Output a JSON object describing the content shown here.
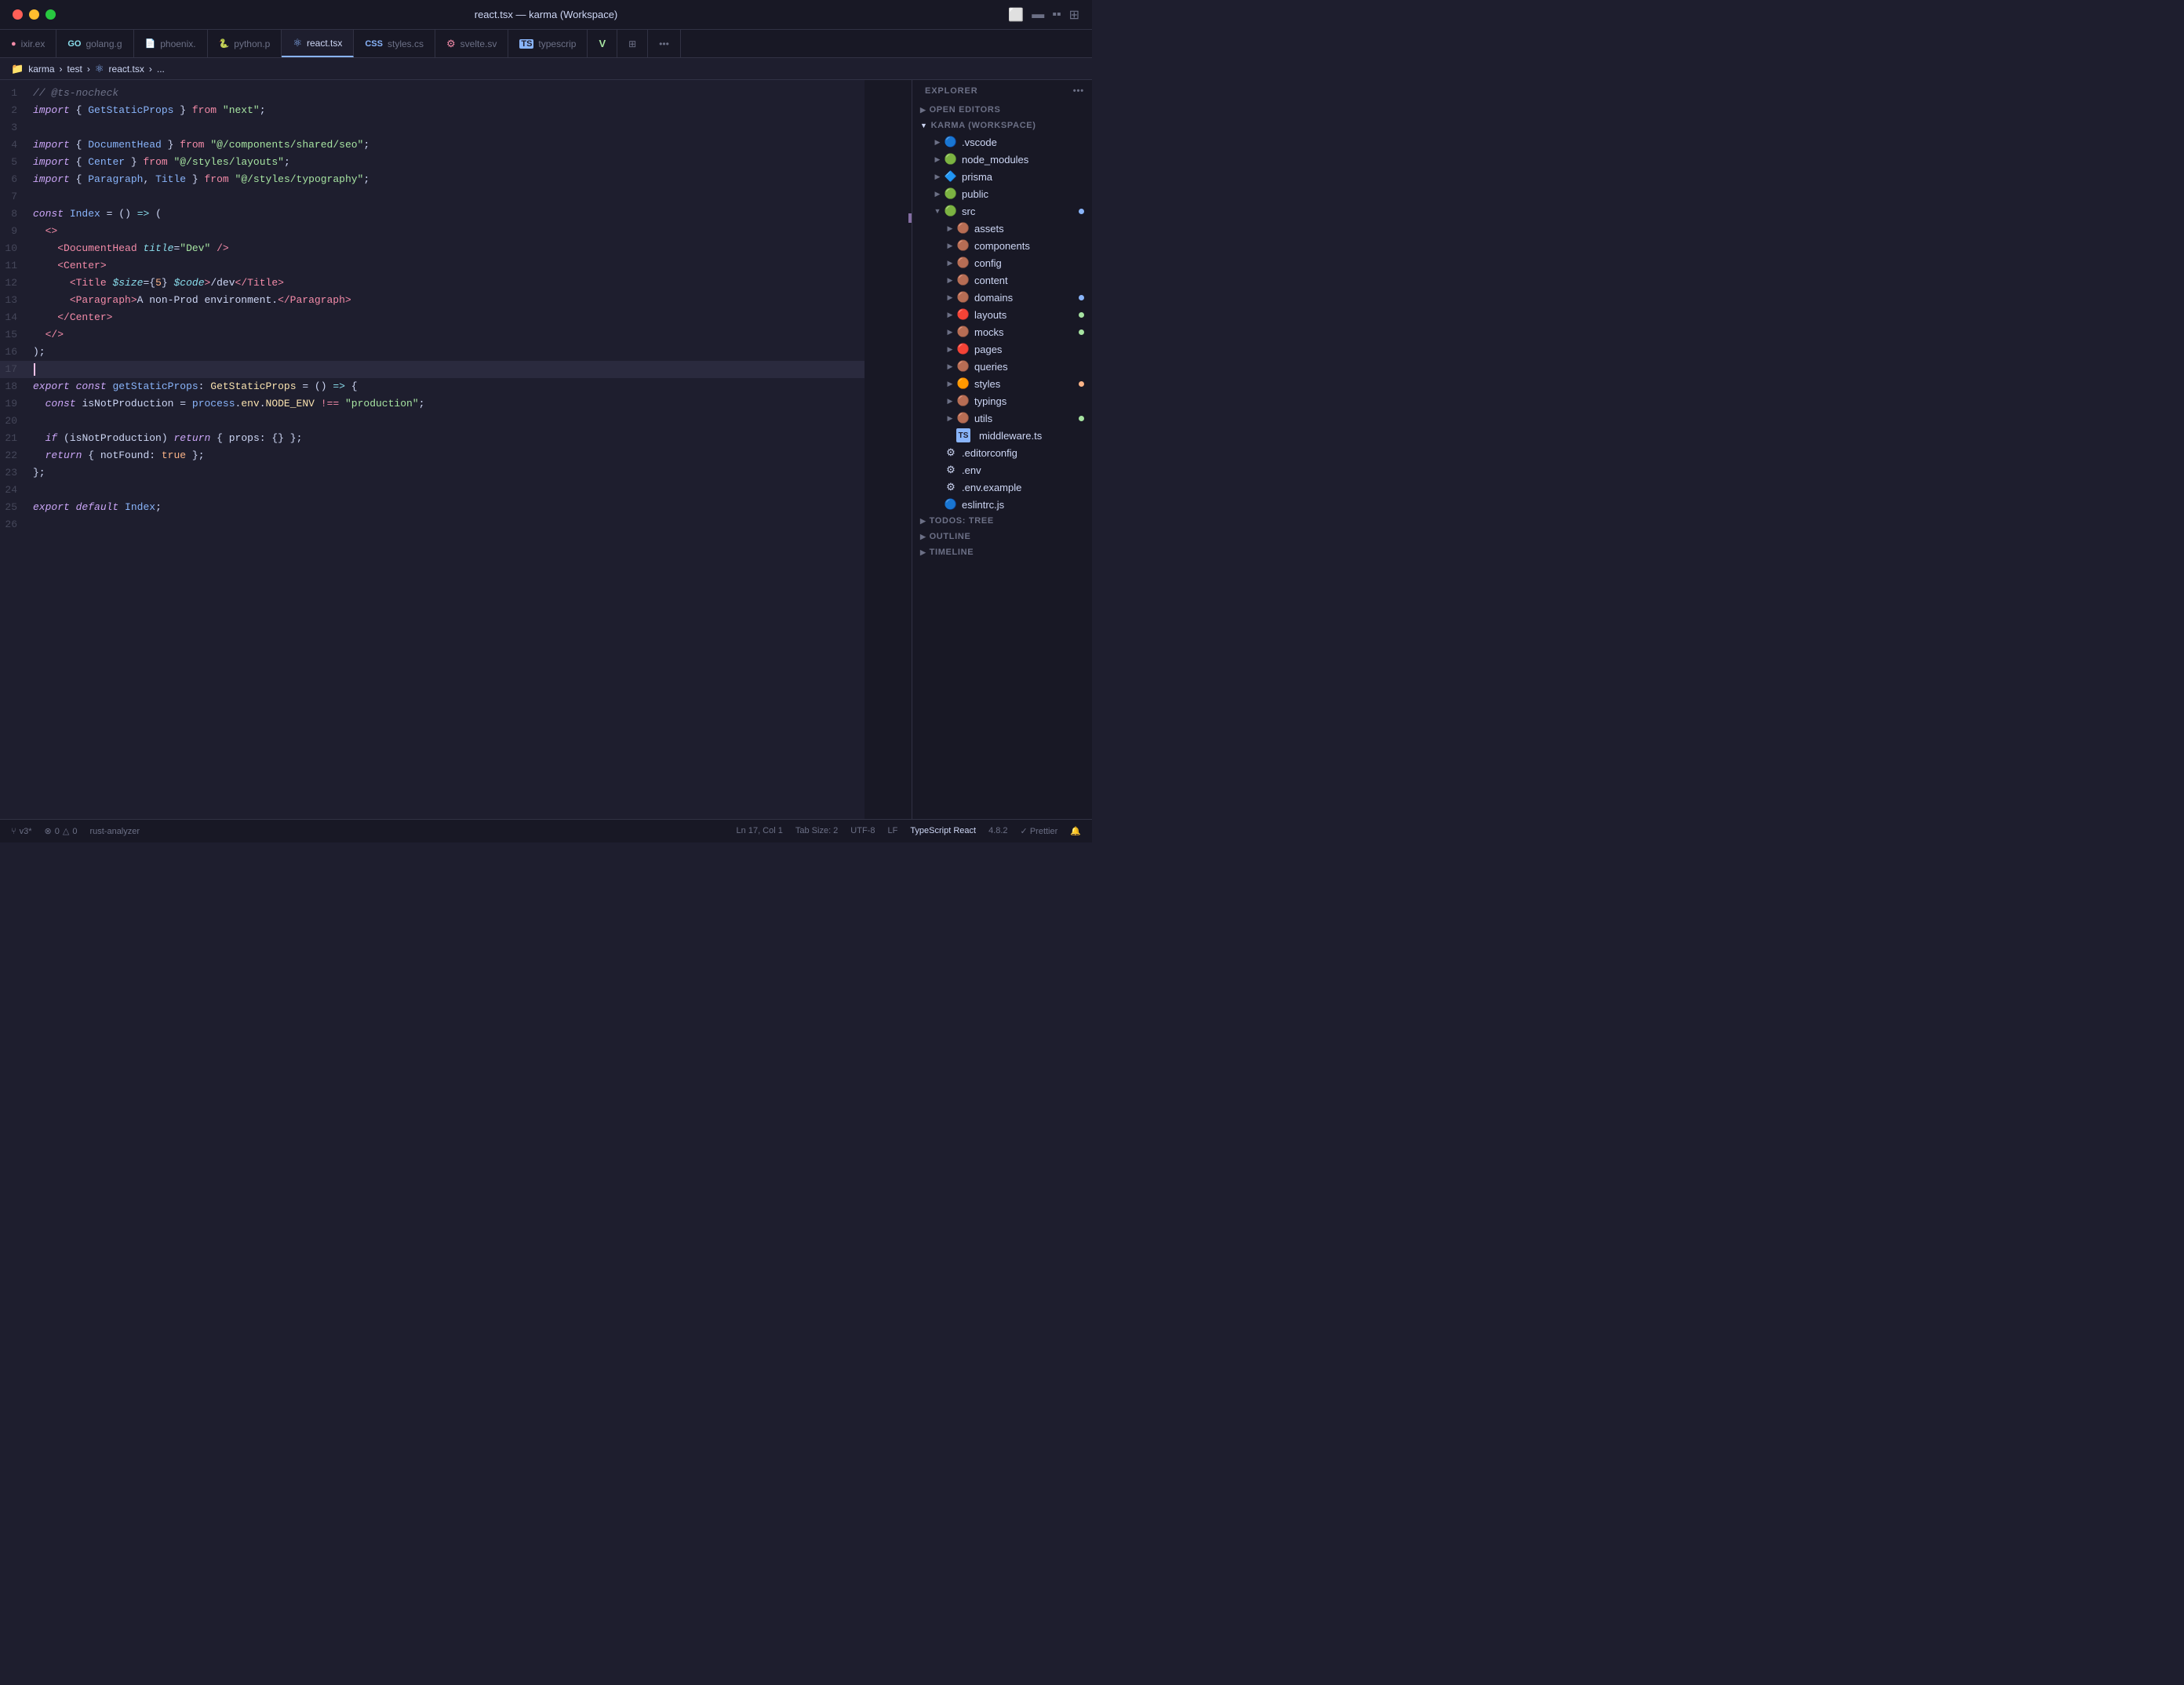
{
  "window": {
    "title": "react.tsx — karma (Workspace)"
  },
  "titlebar": {
    "title": "react.tsx — karma (Workspace)",
    "layout_icons": [
      "⊞",
      "⊟",
      "⊠",
      "⊡"
    ]
  },
  "tabs": [
    {
      "label": "ixir.ex",
      "icon": "🔴",
      "color": "#f38ba8",
      "active": false
    },
    {
      "label": "golang.g",
      "icon": "GO",
      "color": "#89dceb",
      "active": false
    },
    {
      "label": "phoenix.",
      "icon": "📄",
      "color": "#cdd6f4",
      "active": false
    },
    {
      "label": "python.p",
      "icon": "🐍",
      "color": "#f9e2af",
      "active": false
    },
    {
      "label": "react.tsx",
      "icon": "⚛",
      "color": "#89b4fa",
      "active": true
    },
    {
      "label": "styles.cs",
      "icon": "CSS",
      "color": "#89b4fa",
      "active": false
    },
    {
      "label": "svelte.sv",
      "icon": "S",
      "color": "#f38ba8",
      "active": false
    },
    {
      "label": "typescrip",
      "icon": "TS",
      "color": "#89b4fa",
      "active": false
    },
    {
      "label": "V",
      "icon": "V",
      "color": "#a6e3a1",
      "active": false
    },
    {
      "label": "...",
      "icon": "",
      "color": "",
      "active": false
    }
  ],
  "breadcrumb": {
    "parts": [
      "karma",
      "test",
      "react.tsx",
      "..."
    ]
  },
  "code": {
    "lines": [
      {
        "num": 1,
        "content": "// @ts-nocheck",
        "type": "comment"
      },
      {
        "num": 2,
        "content": "import { GetStaticProps } from \"next\";"
      },
      {
        "num": 3,
        "content": ""
      },
      {
        "num": 4,
        "content": "import { DocumentHead } from \"@/components/shared/seo\";"
      },
      {
        "num": 5,
        "content": "import { Center } from \"@/styles/layouts\";"
      },
      {
        "num": 6,
        "content": "import { Paragraph, Title } from \"@/styles/typography\";"
      },
      {
        "num": 7,
        "content": ""
      },
      {
        "num": 8,
        "content": "const Index = () => ("
      },
      {
        "num": 9,
        "content": "  <>"
      },
      {
        "num": 10,
        "content": "    <DocumentHead title=\"Dev\" />"
      },
      {
        "num": 11,
        "content": "    <Center>"
      },
      {
        "num": 12,
        "content": "      <Title $size={5} $code>/dev</Title>"
      },
      {
        "num": 13,
        "content": "      <Paragraph>A non-Prod environment.</Paragraph>"
      },
      {
        "num": 14,
        "content": "    </Center>"
      },
      {
        "num": 15,
        "content": "  </>"
      },
      {
        "num": 16,
        "content": ");"
      },
      {
        "num": 17,
        "content": "",
        "active": true
      },
      {
        "num": 18,
        "content": "export const getStaticProps: GetStaticProps = () => {"
      },
      {
        "num": 19,
        "content": "  const isNotProduction = process.env.NODE_ENV !== \"production\";"
      },
      {
        "num": 20,
        "content": ""
      },
      {
        "num": 21,
        "content": "  if (isNotProduction) return { props: {} };"
      },
      {
        "num": 22,
        "content": "  return { notFound: true };"
      },
      {
        "num": 23,
        "content": "};"
      },
      {
        "num": 24,
        "content": ""
      },
      {
        "num": 25,
        "content": "export default Index;"
      },
      {
        "num": 26,
        "content": ""
      }
    ]
  },
  "sidebar": {
    "header": "EXPLORER",
    "sections": {
      "open_editors": "OPEN EDITORS",
      "workspace": "KARMA (WORKSPACE)"
    },
    "tree": [
      {
        "label": ".vscode",
        "icon": "vscode",
        "indent": 2,
        "expanded": false
      },
      {
        "label": "node_modules",
        "icon": "node",
        "indent": 2,
        "expanded": false
      },
      {
        "label": "prisma",
        "icon": "prisma",
        "indent": 2,
        "expanded": false
      },
      {
        "label": "public",
        "icon": "public",
        "indent": 2,
        "expanded": false
      },
      {
        "label": "src",
        "icon": "src",
        "indent": 2,
        "expanded": true,
        "dot": "blue"
      },
      {
        "label": "assets",
        "icon": "assets",
        "indent": 3,
        "expanded": false
      },
      {
        "label": "components",
        "icon": "components",
        "indent": 3,
        "expanded": false
      },
      {
        "label": "config",
        "icon": "config",
        "indent": 3,
        "expanded": false
      },
      {
        "label": "content",
        "icon": "content",
        "indent": 3,
        "expanded": false
      },
      {
        "label": "domains",
        "icon": "domains",
        "indent": 3,
        "expanded": false,
        "dot": "blue"
      },
      {
        "label": "layouts",
        "icon": "layouts",
        "indent": 3,
        "expanded": false,
        "dot": "green"
      },
      {
        "label": "mocks",
        "icon": "mocks",
        "indent": 3,
        "expanded": false,
        "dot": "green"
      },
      {
        "label": "pages",
        "icon": "pages",
        "indent": 3,
        "expanded": false
      },
      {
        "label": "queries",
        "icon": "queries",
        "indent": 3,
        "expanded": false
      },
      {
        "label": "styles",
        "icon": "styles",
        "indent": 3,
        "expanded": false,
        "dot": "orange"
      },
      {
        "label": "typings",
        "icon": "typings",
        "indent": 3,
        "expanded": false
      },
      {
        "label": "utils",
        "icon": "utils",
        "indent": 3,
        "expanded": false,
        "dot": "green"
      },
      {
        "label": "middleware.ts",
        "icon": "ts",
        "indent": 3,
        "file": true
      },
      {
        "label": ".editorconfig",
        "icon": "editorconfig",
        "indent": 2,
        "file": true
      },
      {
        "label": ".env",
        "icon": "env",
        "indent": 2,
        "file": true
      },
      {
        "label": ".env.example",
        "icon": "env",
        "indent": 2,
        "file": true
      },
      {
        "label": "eslintrc.js",
        "icon": "eslint",
        "indent": 2,
        "file": true
      }
    ],
    "bottom_sections": [
      "TODOS: TREE",
      "OUTLINE",
      "TIMELINE"
    ]
  },
  "statusbar": {
    "git": "v3*",
    "errors": "0",
    "warnings": "0",
    "rust_analyzer": "rust-analyzer",
    "position": "Ln 17, Col 1",
    "tab_size": "Tab Size: 2",
    "encoding": "UTF-8",
    "line_ending": "LF",
    "language": "TypeScript React",
    "version": "4.8.2",
    "formatter": "Prettier",
    "bell": "🔔"
  }
}
